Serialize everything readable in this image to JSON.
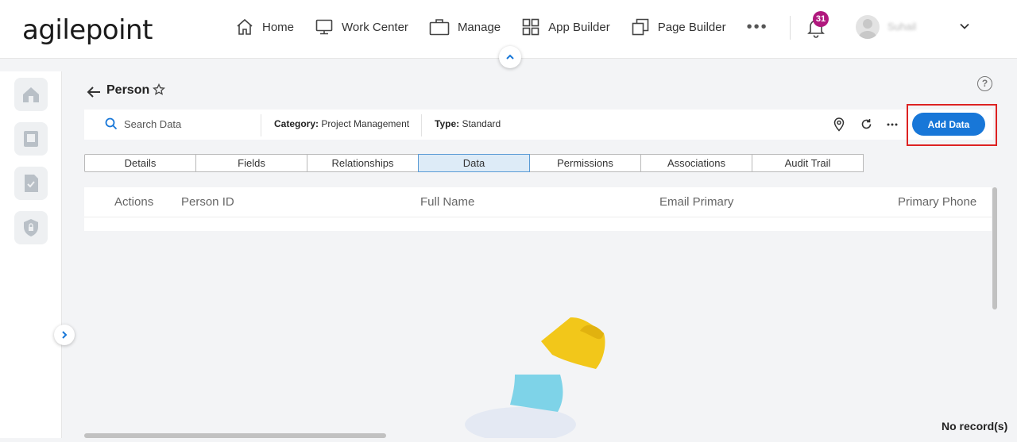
{
  "header": {
    "logo": "agilepoint",
    "nav": [
      {
        "label": "Home",
        "icon": "home-icon"
      },
      {
        "label": "Work Center",
        "icon": "monitor-icon"
      },
      {
        "label": "Manage",
        "icon": "briefcase-icon"
      },
      {
        "label": "App Builder",
        "icon": "grid-icon"
      },
      {
        "label": "Page Builder",
        "icon": "pages-icon"
      }
    ],
    "more": "•••",
    "notification_count": "31",
    "user_name": "Suhail"
  },
  "page": {
    "title": "Person",
    "help": "?"
  },
  "toolbar": {
    "search_placeholder": "Search Data",
    "category_label": "Category:",
    "category_value": "Project Management",
    "type_label": "Type:",
    "type_value": "Standard",
    "add_label": "Add Data"
  },
  "tabs": [
    {
      "label": "Details",
      "active": false
    },
    {
      "label": "Fields",
      "active": false
    },
    {
      "label": "Relationships",
      "active": false
    },
    {
      "label": "Data",
      "active": true
    },
    {
      "label": "Permissions",
      "active": false
    },
    {
      "label": "Associations",
      "active": false
    },
    {
      "label": "Audit Trail",
      "active": false
    }
  ],
  "grid": {
    "columns": [
      "Actions",
      "Person ID",
      "Full Name",
      "Email Primary",
      "Primary Phone"
    ]
  },
  "empty_state": "No record(s)",
  "colors": {
    "accent": "#1877d8",
    "badge": "#b0187d",
    "highlight": "#dd2222"
  }
}
